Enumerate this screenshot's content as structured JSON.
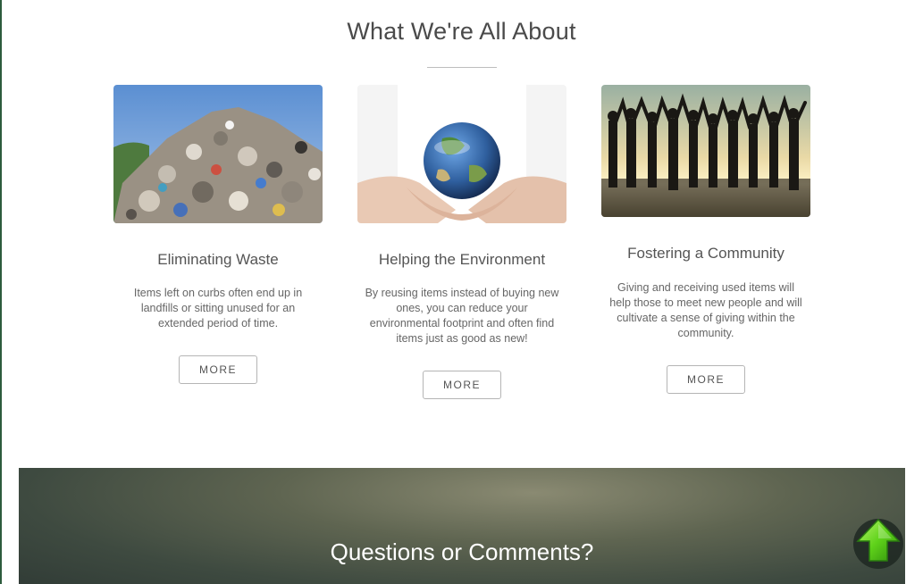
{
  "section": {
    "title": "What We're All About"
  },
  "cards": [
    {
      "title": "Eliminating Waste",
      "text": "Items left on curbs often end up in landfills or sitting unused for an extended period of time.",
      "button": "MORE",
      "image": "landfill-photo"
    },
    {
      "title": "Helping the Environment",
      "text": "By reusing items instead of buying new ones, you can reduce your environmental footprint and often find items just as good as new!",
      "button": "MORE",
      "image": "earth-in-hands-photo"
    },
    {
      "title": "Fostering a Community",
      "text": "Giving and receiving used items will help those to meet new people and will cultivate a sense of giving within the community.",
      "button": "MORE",
      "image": "community-silhouettes-photo"
    }
  ],
  "contact": {
    "title": "Questions or Comments?"
  },
  "scroll_top": {
    "icon": "green-up-arrow-icon"
  },
  "colors": {
    "accent_green": "#5fd21a",
    "band_dark": "#3e4a40"
  }
}
